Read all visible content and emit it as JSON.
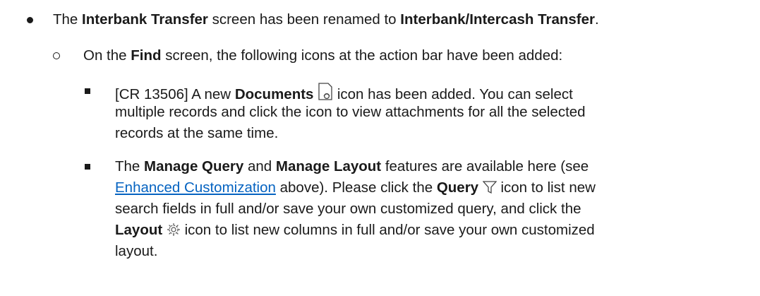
{
  "b1": {
    "t1": "The ",
    "b_old": "Interbank Transfer",
    "t2": " screen has been renamed to ",
    "b_new": "Interbank/Intercash Transfer",
    "t3": "."
  },
  "b2": {
    "t1": "On the ",
    "b_find": "Find",
    "t2": " screen, the following icons at the action bar have been added:"
  },
  "b3": {
    "t1": "[CR 13506] A new ",
    "b_docs": "Documents",
    "t2": " icon has been added. You can select",
    "line2": "multiple records and click the icon to view attachments for all the selected",
    "line3": "records at the same time."
  },
  "b4": {
    "t1": "The ",
    "b_mq": "Manage Query",
    "t2": " and ",
    "b_ml": "Manage Layout",
    "t3": " features are available here (see",
    "link": "Enhanced Customization",
    "t4": " above). Please click the ",
    "b_query": "Query",
    "t5": " icon to list new",
    "line3": "search fields in full and/or save your own customized query, and click the",
    "b_layout": "Layout",
    "t6": " icon to list new columns in full and/or save your own customized",
    "line5": "layout."
  },
  "icons": {
    "documents": "document-attachment-icon",
    "query": "funnel-filter-icon",
    "layout": "gear-icon"
  },
  "colors": {
    "text": "#1a1a1a",
    "link": "#0563c1"
  }
}
